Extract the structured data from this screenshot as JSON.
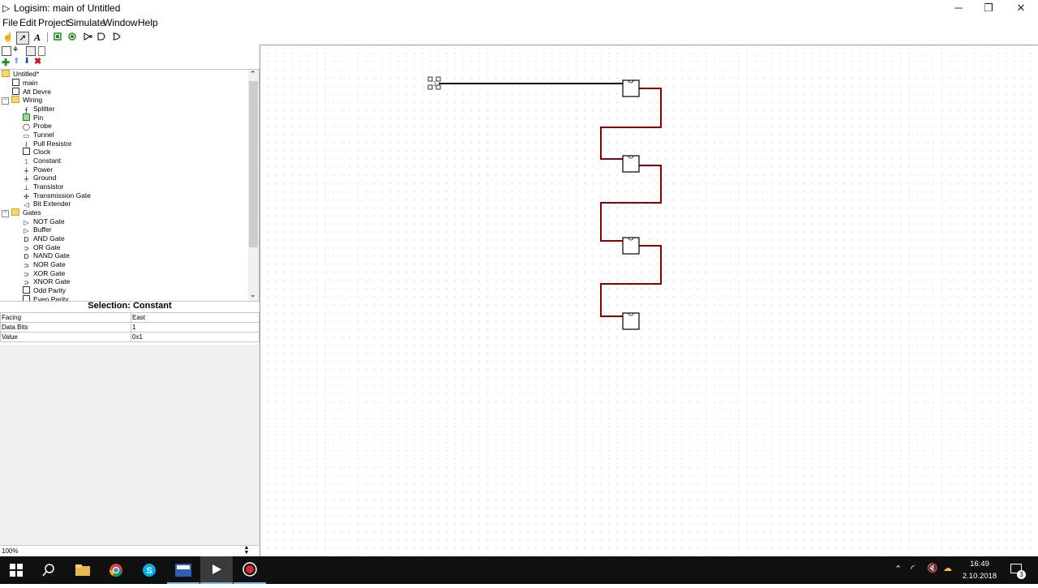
{
  "window": {
    "title": "Logisim: main of Untitled",
    "icon": "logisim-gate-icon",
    "controls": {
      "minimize": "─",
      "maximize": "❐",
      "close": "✕"
    }
  },
  "menubar": {
    "items": [
      "File",
      "Edit",
      "Project",
      "Simulate",
      "Window",
      "Help"
    ]
  },
  "toolbar": {
    "tools": [
      "poke-tool",
      "select-tool",
      "text-tool",
      "input-pin",
      "output-pin",
      "not-gate",
      "and-gate",
      "or-gate"
    ],
    "text_tool_label": "A"
  },
  "explorer": {
    "project": "Untitled*",
    "circuits": [
      "main",
      "Alt Devre"
    ],
    "folders": [
      {
        "name": "Wiring",
        "items": [
          "Splitter",
          "Pin",
          "Probe",
          "Tunnel",
          "Pull Resistor",
          "Clock",
          "Constant",
          "Power",
          "Ground",
          "Transistor",
          "Transmission Gate",
          "Bit Extender"
        ]
      },
      {
        "name": "Gates",
        "items": [
          "NOT Gate",
          "Buffer",
          "AND Gate",
          "OR Gate",
          "NAND Gate",
          "NOR Gate",
          "XOR Gate",
          "XNOR Gate",
          "Odd Parity",
          "Even Parity"
        ]
      }
    ]
  },
  "selection": {
    "title": "Selection: Constant",
    "attributes": [
      {
        "name": "Facing",
        "value": "East"
      },
      {
        "name": "Data Bits",
        "value": "1"
      },
      {
        "name": "Value",
        "value": "0x1"
      }
    ]
  },
  "zoom": "100%",
  "canvas": {
    "constant_label": "1",
    "wire_colors": {
      "idle": "#000000",
      "error": "#8b0000"
    }
  },
  "taskbar": {
    "apps": [
      "windows-start",
      "search",
      "file-explorer",
      "chrome",
      "skype",
      "dev-cpp",
      "logisim",
      "recorder"
    ],
    "time": "16:49",
    "date": "2.10.2018",
    "notification_count": "3"
  }
}
